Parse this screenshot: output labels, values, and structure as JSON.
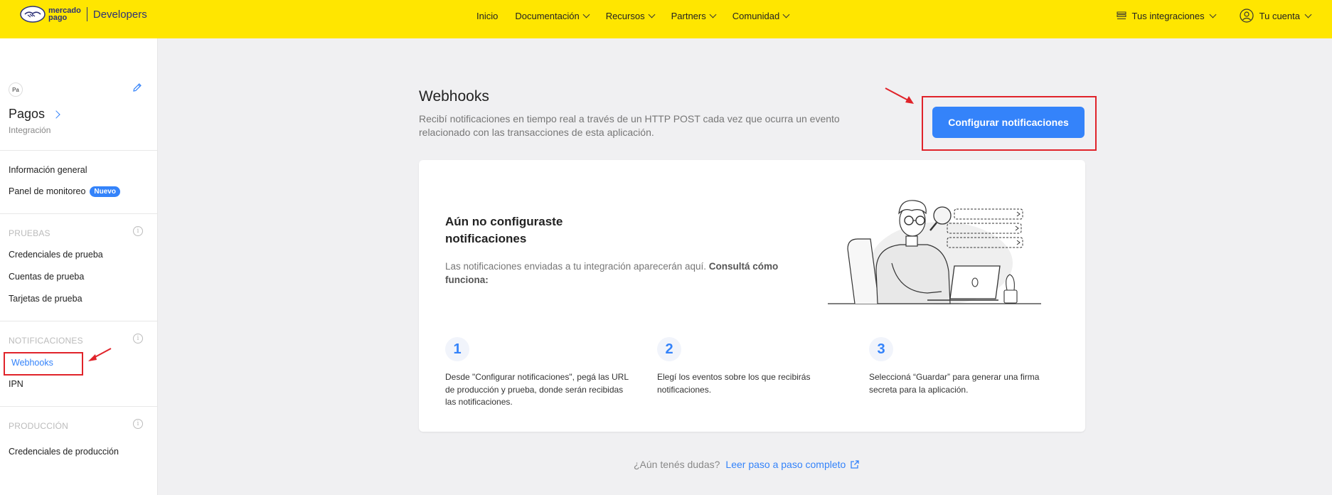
{
  "header": {
    "brand_line1": "mercado",
    "brand_line2": "pago",
    "brand_product": "Developers",
    "nav": [
      {
        "label": "Inicio"
      },
      {
        "label": "Documentación"
      },
      {
        "label": "Recursos"
      },
      {
        "label": "Partners"
      },
      {
        "label": "Comunidad"
      }
    ],
    "integrations_label": "Tus integraciones",
    "account_label": "Tu cuenta"
  },
  "sidebar": {
    "app_initials": "Pa",
    "app_name": "Pagos",
    "app_type": "Integración",
    "general": [
      {
        "label": "Información general"
      },
      {
        "label": "Panel de monitoreo",
        "badge": "Nuevo"
      }
    ],
    "tests_section": "PRUEBAS",
    "tests": [
      {
        "label": "Credenciales de prueba"
      },
      {
        "label": "Cuentas de prueba"
      },
      {
        "label": "Tarjetas de prueba"
      }
    ],
    "notifications_section": "NOTIFICACIONES",
    "notifications": [
      {
        "label": "Webhooks",
        "active": true
      },
      {
        "label": "IPN"
      }
    ],
    "production_section": "PRODUCCIÓN",
    "production": [
      {
        "label": "Credenciales de producción"
      }
    ]
  },
  "main": {
    "title": "Webhooks",
    "description": "Recibí notificaciones en tiempo real a través de un HTTP POST cada vez que ocurra un evento relacionado con las transacciones de esta aplicación.",
    "configure_button": "Configurar notificaciones",
    "empty_title": "Aún no configuraste notificaciones",
    "empty_desc_plain": "Las notificaciones enviadas a tu integración aparecerán aquí. ",
    "empty_desc_bold": "Consultá cómo funciona:",
    "steps": [
      {
        "number": "1",
        "text": "Desde \"Configurar notificaciones\", pegá las URL de producción y prueba, donde serán recibidas las notificaciones."
      },
      {
        "number": "2",
        "text": "Elegí los eventos sobre los que recibirás notificaciones."
      },
      {
        "number": "3",
        "text": "Seleccioná “Guardar” para generar una firma secreta para la aplicación."
      }
    ]
  },
  "footer": {
    "question": "¿Aún tenés dudas?",
    "link": "Leer paso a paso completo"
  },
  "colors": {
    "header_bg": "#ffe600",
    "accent": "#3483fa",
    "annotation": "#e0232a"
  }
}
